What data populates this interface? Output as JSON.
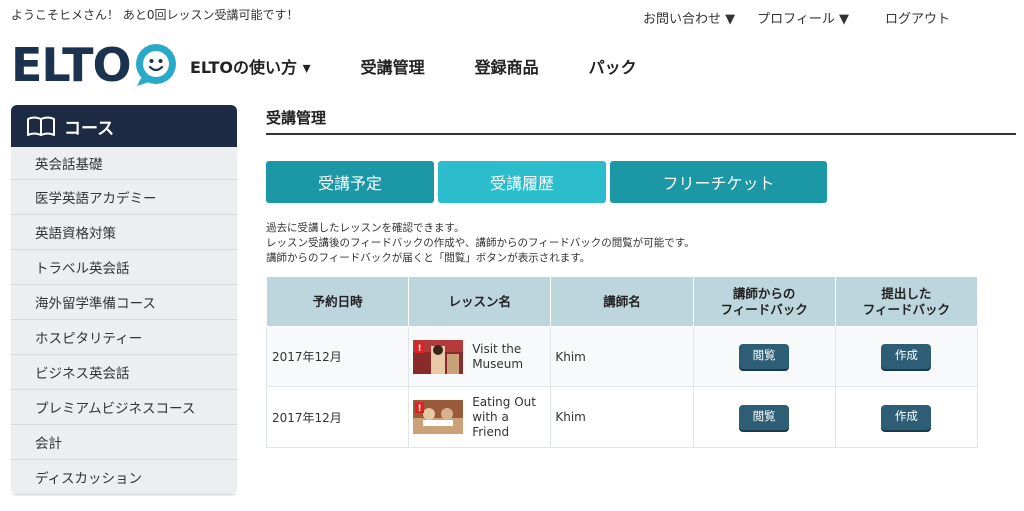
{
  "header": {
    "welcome": "ようこそヒメさん！ あと0回レッスン受講可能です！",
    "top_links": [
      "お問い合わせ ▼",
      "プロフィール ▼",
      "ログアウト"
    ],
    "logo_text": "ELTO",
    "main_nav": [
      "ELTOの使い方 ▾",
      "受講管理",
      "登録商品",
      "パック"
    ]
  },
  "sidebar": {
    "title": "コース",
    "items": [
      "英会話基礎",
      "医学英語アカデミー",
      "英語資格対策",
      "トラベル英会話",
      "海外留学準備コース",
      "ホスピタリティー",
      "ビジネス英会話",
      "プレミアムビジネスコース",
      "会計",
      "ディスカッション"
    ]
  },
  "main": {
    "title": "受講管理",
    "tabs": [
      "受講予定",
      "受講履歴",
      "フリーチケット"
    ],
    "description": [
      "過去に受講したレッスンを確認できます。",
      "レッスン受講後のフィードバックの作成や、講師からのフィードバックの閲覧が可能です。",
      "講師からのフィードバックが届くと「閲覧」ボタンが表示されます。"
    ],
    "table": {
      "headers": [
        "予約日時",
        "レッスン名",
        "講師名",
        "講師からの",
        "フィードバック",
        "提出した",
        "フィードバック"
      ],
      "rows": [
        {
          "date": "2017年12月",
          "lesson_line1": "Visit the",
          "lesson_line2": "Museum",
          "lesson_line3": "",
          "teacher": "Khim",
          "view_label": "閲覧",
          "create_label": "作成"
        },
        {
          "date": "2017年12月",
          "lesson_line1": "Eating Out",
          "lesson_line2": "with a",
          "lesson_line3": "Friend",
          "teacher": "Khim",
          "view_label": "閲覧",
          "create_label": "作成"
        }
      ]
    }
  },
  "colors": {
    "navy": "#1c2a44",
    "teal": "#1b97a5",
    "teal_active": "#2bbdcc",
    "button": "#2d5e76",
    "header_cell": "#bdd5dd",
    "logo_face": "#29a9c9"
  }
}
